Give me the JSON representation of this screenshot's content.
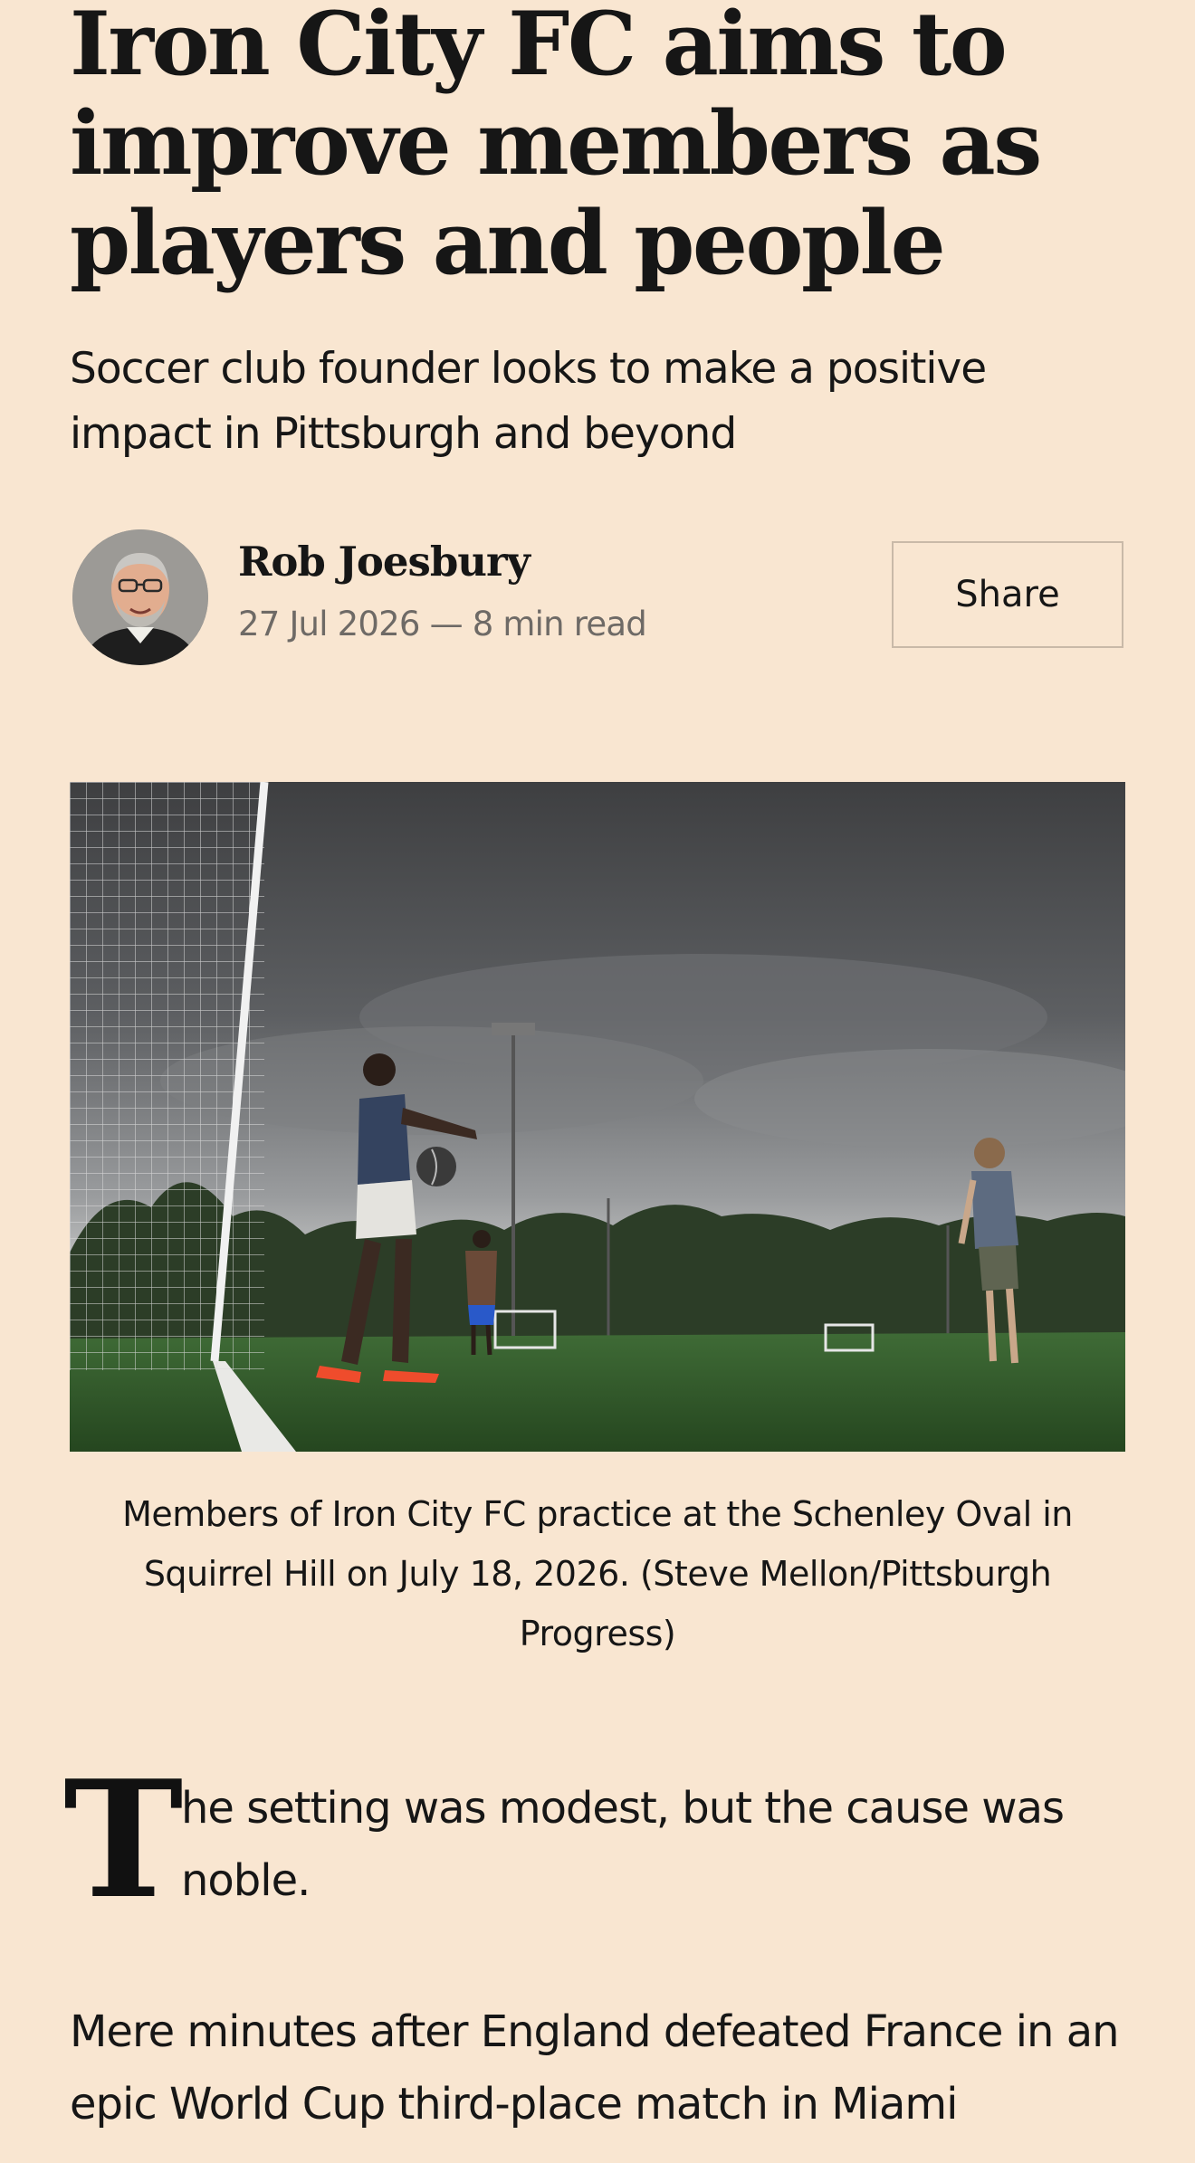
{
  "article": {
    "headline": "Iron City FC aims to improve members as players and people",
    "subheadline": "Soccer club founder looks to make a positive impact in Pittsburgh and beyond",
    "author": {
      "name": "Rob Joesbury",
      "meta": "27 Jul 2026 — 8 min read"
    },
    "share_label": "Share",
    "photo_caption": "Members of Iron City FC practice at the Schenley Oval in Squirrel Hill on July 18, 2026. (Steve Mellon/Pittsburgh Progress)",
    "body": {
      "drop_cap": "T",
      "lead_rest": "he setting was modest, but the cause was noble.",
      "paragraph_2": "Mere minutes after England defeated France in an epic World Cup third-place match in Miami"
    }
  },
  "colors": {
    "background": "#f9e6d1",
    "text": "#161616",
    "muted": "#6e6a66",
    "button_border": "#c9b9a8"
  }
}
